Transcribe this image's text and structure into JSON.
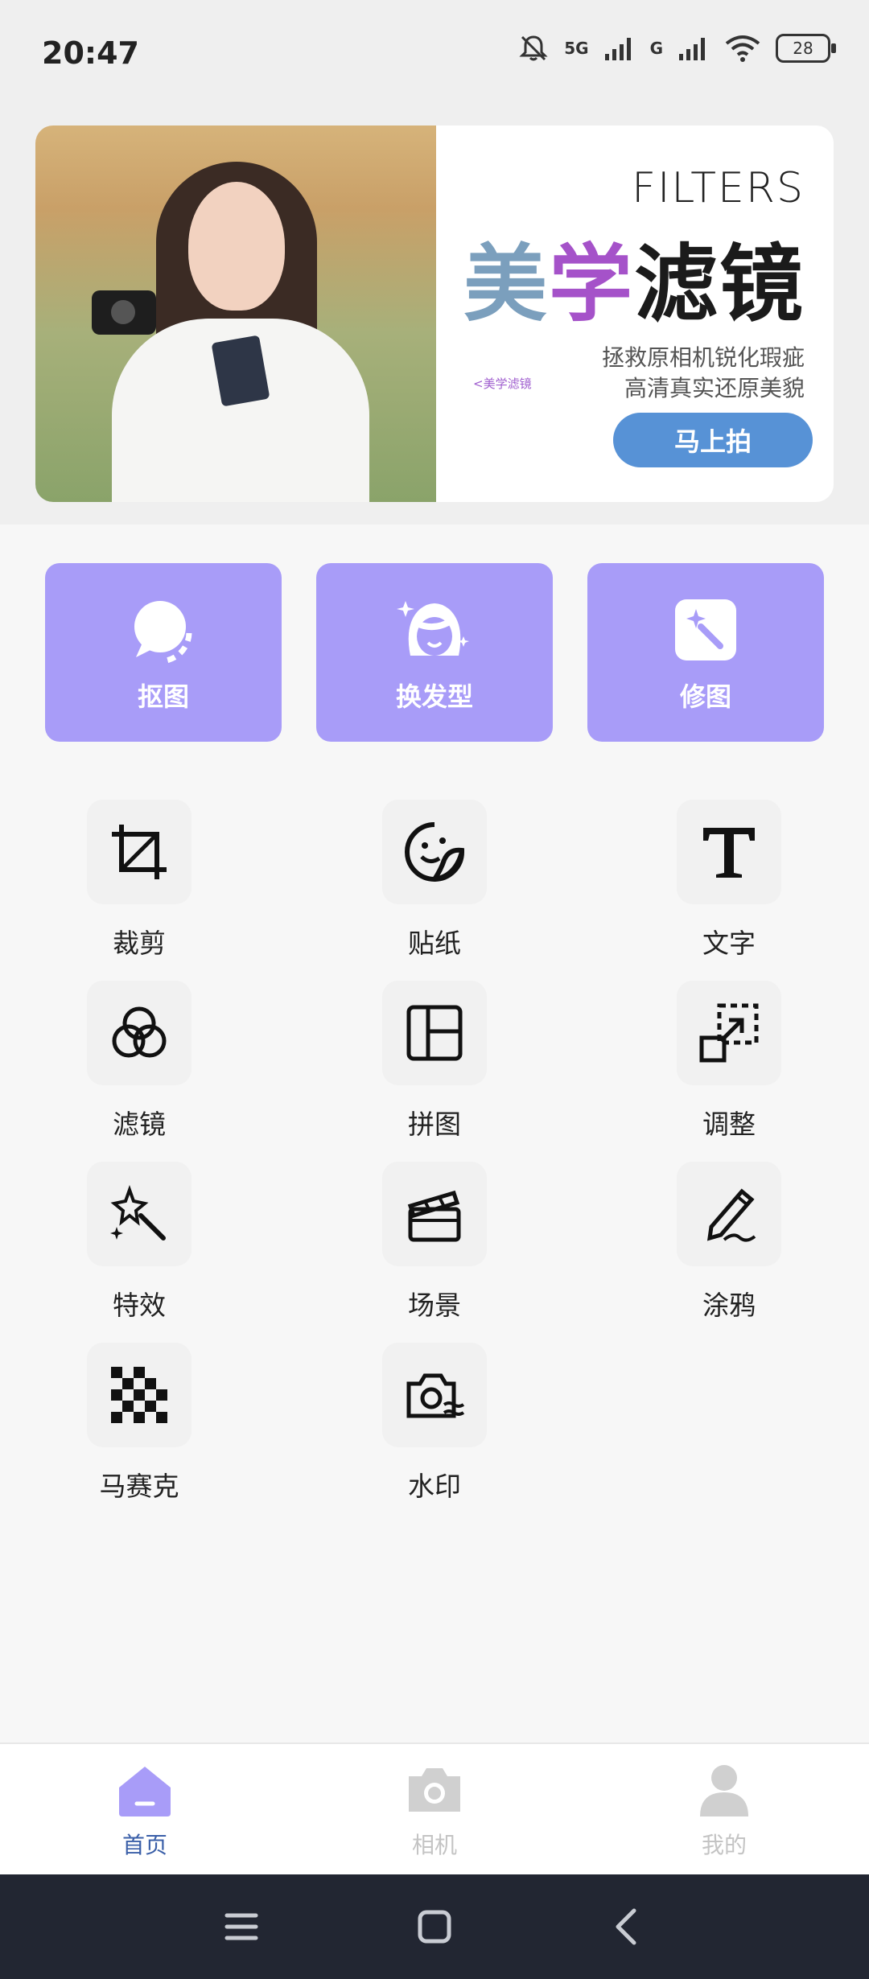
{
  "status": {
    "time": "20:47",
    "net1": "5G",
    "net2": "G",
    "battery": "28"
  },
  "banner": {
    "title_en": "FILTERS",
    "title_cn_1": "美",
    "title_cn_2": "学",
    "title_cn_3": "滤镜",
    "slogan_1": "拯救原相机锐化瑕疵",
    "slogan_2": "高清真实还原美貌",
    "mini_tag": "<美学滤镜",
    "button": "马上拍"
  },
  "features": [
    {
      "label": "抠图",
      "icon": "cutout-bubble-icon"
    },
    {
      "label": "换发型",
      "icon": "hairstyle-face-icon"
    },
    {
      "label": "修图",
      "icon": "magic-wand-icon"
    }
  ],
  "tools": [
    {
      "label": "裁剪",
      "icon": "crop-icon"
    },
    {
      "label": "贴纸",
      "icon": "sticker-icon"
    },
    {
      "label": "文字",
      "icon": "text-icon"
    },
    {
      "label": "滤镜",
      "icon": "filter-circles-icon"
    },
    {
      "label": "拼图",
      "icon": "collage-icon"
    },
    {
      "label": "调整",
      "icon": "resize-icon"
    },
    {
      "label": "特效",
      "icon": "effects-wand-icon"
    },
    {
      "label": "场景",
      "icon": "clapperboard-icon"
    },
    {
      "label": "涂鸦",
      "icon": "pen-doodle-icon"
    },
    {
      "label": "马赛克",
      "icon": "mosaic-icon"
    },
    {
      "label": "水印",
      "icon": "watermark-camera-icon"
    }
  ],
  "tabs": [
    {
      "label": "首页",
      "active": true,
      "icon": "home-icon"
    },
    {
      "label": "相机",
      "active": false,
      "icon": "camera-icon"
    },
    {
      "label": "我的",
      "active": false,
      "icon": "user-icon"
    }
  ],
  "colors": {
    "accent": "#a89cf8",
    "button_blue": "#5792d6",
    "tab_active": "#3a5fa8",
    "tab_inactive": "#c4c4c4"
  }
}
